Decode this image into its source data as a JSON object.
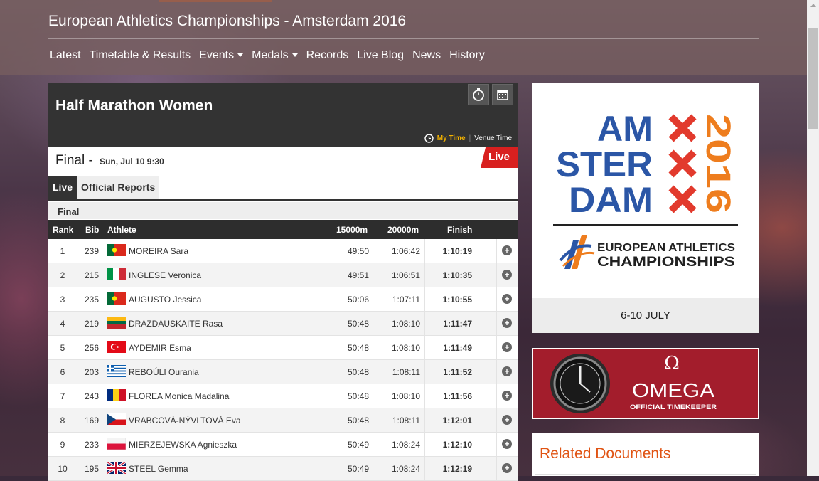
{
  "site": {
    "title": "European Athletics Championships - Amsterdam 2016"
  },
  "nav": [
    {
      "label": "Latest",
      "caret": false
    },
    {
      "label": "Timetable & Results",
      "caret": false
    },
    {
      "label": "Events",
      "caret": true
    },
    {
      "label": "Medals",
      "caret": true
    },
    {
      "label": "Records",
      "caret": false
    },
    {
      "label": "Live Blog",
      "caret": false
    },
    {
      "label": "News",
      "caret": false
    },
    {
      "label": "History",
      "caret": false
    }
  ],
  "event": {
    "title": "Half Marathon Women",
    "time_toggle": {
      "my_time": "My Time",
      "separator": "|",
      "venue_time": "Venue Time"
    },
    "round": "Final",
    "round_date": "Sun, Jul 10 9:30",
    "live_badge": "Live",
    "tabs": [
      "Live",
      "Official Reports"
    ],
    "section": "Final"
  },
  "table": {
    "headers": {
      "rank": "Rank",
      "bib": "Bib",
      "athlete": "Athlete",
      "split1": "15000m",
      "split2": "20000m",
      "finish": "Finish"
    },
    "rows": [
      {
        "rank": "1",
        "bib": "239",
        "country": "POR",
        "name": "MOREIRA Sara",
        "s15": "49:50",
        "s20": "1:06:42",
        "finish": "1:10:19"
      },
      {
        "rank": "2",
        "bib": "215",
        "country": "ITA",
        "name": "INGLESE Veronica",
        "s15": "49:51",
        "s20": "1:06:51",
        "finish": "1:10:35"
      },
      {
        "rank": "3",
        "bib": "235",
        "country": "POR",
        "name": "AUGUSTO Jessica",
        "s15": "50:06",
        "s20": "1:07:11",
        "finish": "1:10:55"
      },
      {
        "rank": "4",
        "bib": "219",
        "country": "LTU",
        "name": "DRAZDAUSKAITE Rasa",
        "s15": "50:48",
        "s20": "1:08:10",
        "finish": "1:11:47"
      },
      {
        "rank": "5",
        "bib": "256",
        "country": "TUR",
        "name": "AYDEMIR Esma",
        "s15": "50:48",
        "s20": "1:08:10",
        "finish": "1:11:49"
      },
      {
        "rank": "6",
        "bib": "203",
        "country": "GRE",
        "name": "REBOÚLI Ourania",
        "s15": "50:48",
        "s20": "1:08:11",
        "finish": "1:11:52"
      },
      {
        "rank": "7",
        "bib": "243",
        "country": "ROU",
        "name": "FLOREA Monica Madalina",
        "s15": "50:48",
        "s20": "1:08:10",
        "finish": "1:11:56"
      },
      {
        "rank": "8",
        "bib": "169",
        "country": "CZE",
        "name": "VRABCOVÁ-NÝVLTOVÁ Eva",
        "s15": "50:48",
        "s20": "1:08:11",
        "finish": "1:12:01"
      },
      {
        "rank": "9",
        "bib": "233",
        "country": "POL",
        "name": "MIERZEJEWSKA Agnieszka",
        "s15": "50:49",
        "s20": "1:08:24",
        "finish": "1:12:10"
      },
      {
        "rank": "10",
        "bib": "195",
        "country": "GBR",
        "name": "STEEL Gemma",
        "s15": "50:49",
        "s20": "1:08:24",
        "finish": "1:12:19"
      }
    ]
  },
  "sidebar": {
    "logo": {
      "lines": [
        "AM",
        "STER",
        "DAM"
      ],
      "year": "2016",
      "sub1": "EUROPEAN ATHLETICS",
      "sub2": "CHAMPIONSHIPS",
      "dates": "6-10 JULY"
    },
    "omega": {
      "brand": "OMEGA",
      "tagline": "OFFICIAL TIMEKEEPER"
    },
    "related_title": "Related Documents"
  },
  "colors": {
    "accent": "#e05414",
    "live": "#d8201f",
    "logo_blue": "#2b56a6",
    "logo_red": "#e23a2d",
    "logo_orange": "#ee7d1e",
    "omega_red": "#a31d2c",
    "mytime": "#f5b400"
  }
}
